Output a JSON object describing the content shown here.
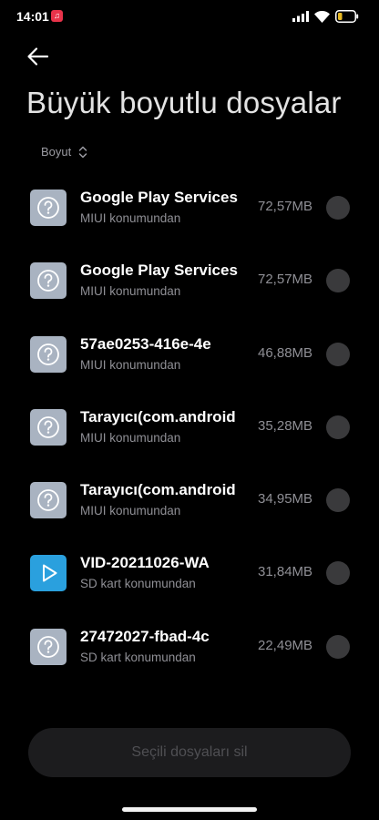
{
  "status_bar": {
    "time": "14:01",
    "icons": [
      "music-icon",
      "signal-icon",
      "wifi-icon",
      "battery-icon"
    ]
  },
  "header": {
    "back_icon": "arrow-left-icon",
    "title": "Büyük boyutlu dosyalar"
  },
  "sort": {
    "label": "Boyut",
    "icon": "sort-updown-icon"
  },
  "files": [
    {
      "name": "Google Play Services",
      "location": "MIUI konumundan",
      "size": "72,57MB",
      "icon": "unknown-file-icon"
    },
    {
      "name": "Google Play Services",
      "location": "MIUI konumundan",
      "size": "72,57MB",
      "icon": "unknown-file-icon"
    },
    {
      "name": "57ae0253-416e-4e",
      "location": "MIUI konumundan",
      "size": "46,88MB",
      "icon": "unknown-file-icon"
    },
    {
      "name": "Tarayıcı(com.android",
      "location": "MIUI konumundan",
      "size": "35,28MB",
      "icon": "unknown-file-icon"
    },
    {
      "name": "Tarayıcı(com.android",
      "location": "MIUI konumundan",
      "size": "34,95MB",
      "icon": "unknown-file-icon"
    },
    {
      "name": "VID-20211026-WA",
      "location": "SD kart konumundan",
      "size": "31,84MB",
      "icon": "video-file-icon"
    },
    {
      "name": "27472027-fbad-4c",
      "location": "SD kart konumundan",
      "size": "22,49MB",
      "icon": "unknown-file-icon"
    }
  ],
  "delete_button": {
    "label": "Seçili dosyaları sil"
  },
  "colors": {
    "background": "#000000",
    "unknown_icon": "#a9b3c1",
    "video_icon": "#2aa0de",
    "checkbox": "#3a3a3c",
    "music_app": "#e8334a",
    "battery_level": "#e8b923"
  }
}
